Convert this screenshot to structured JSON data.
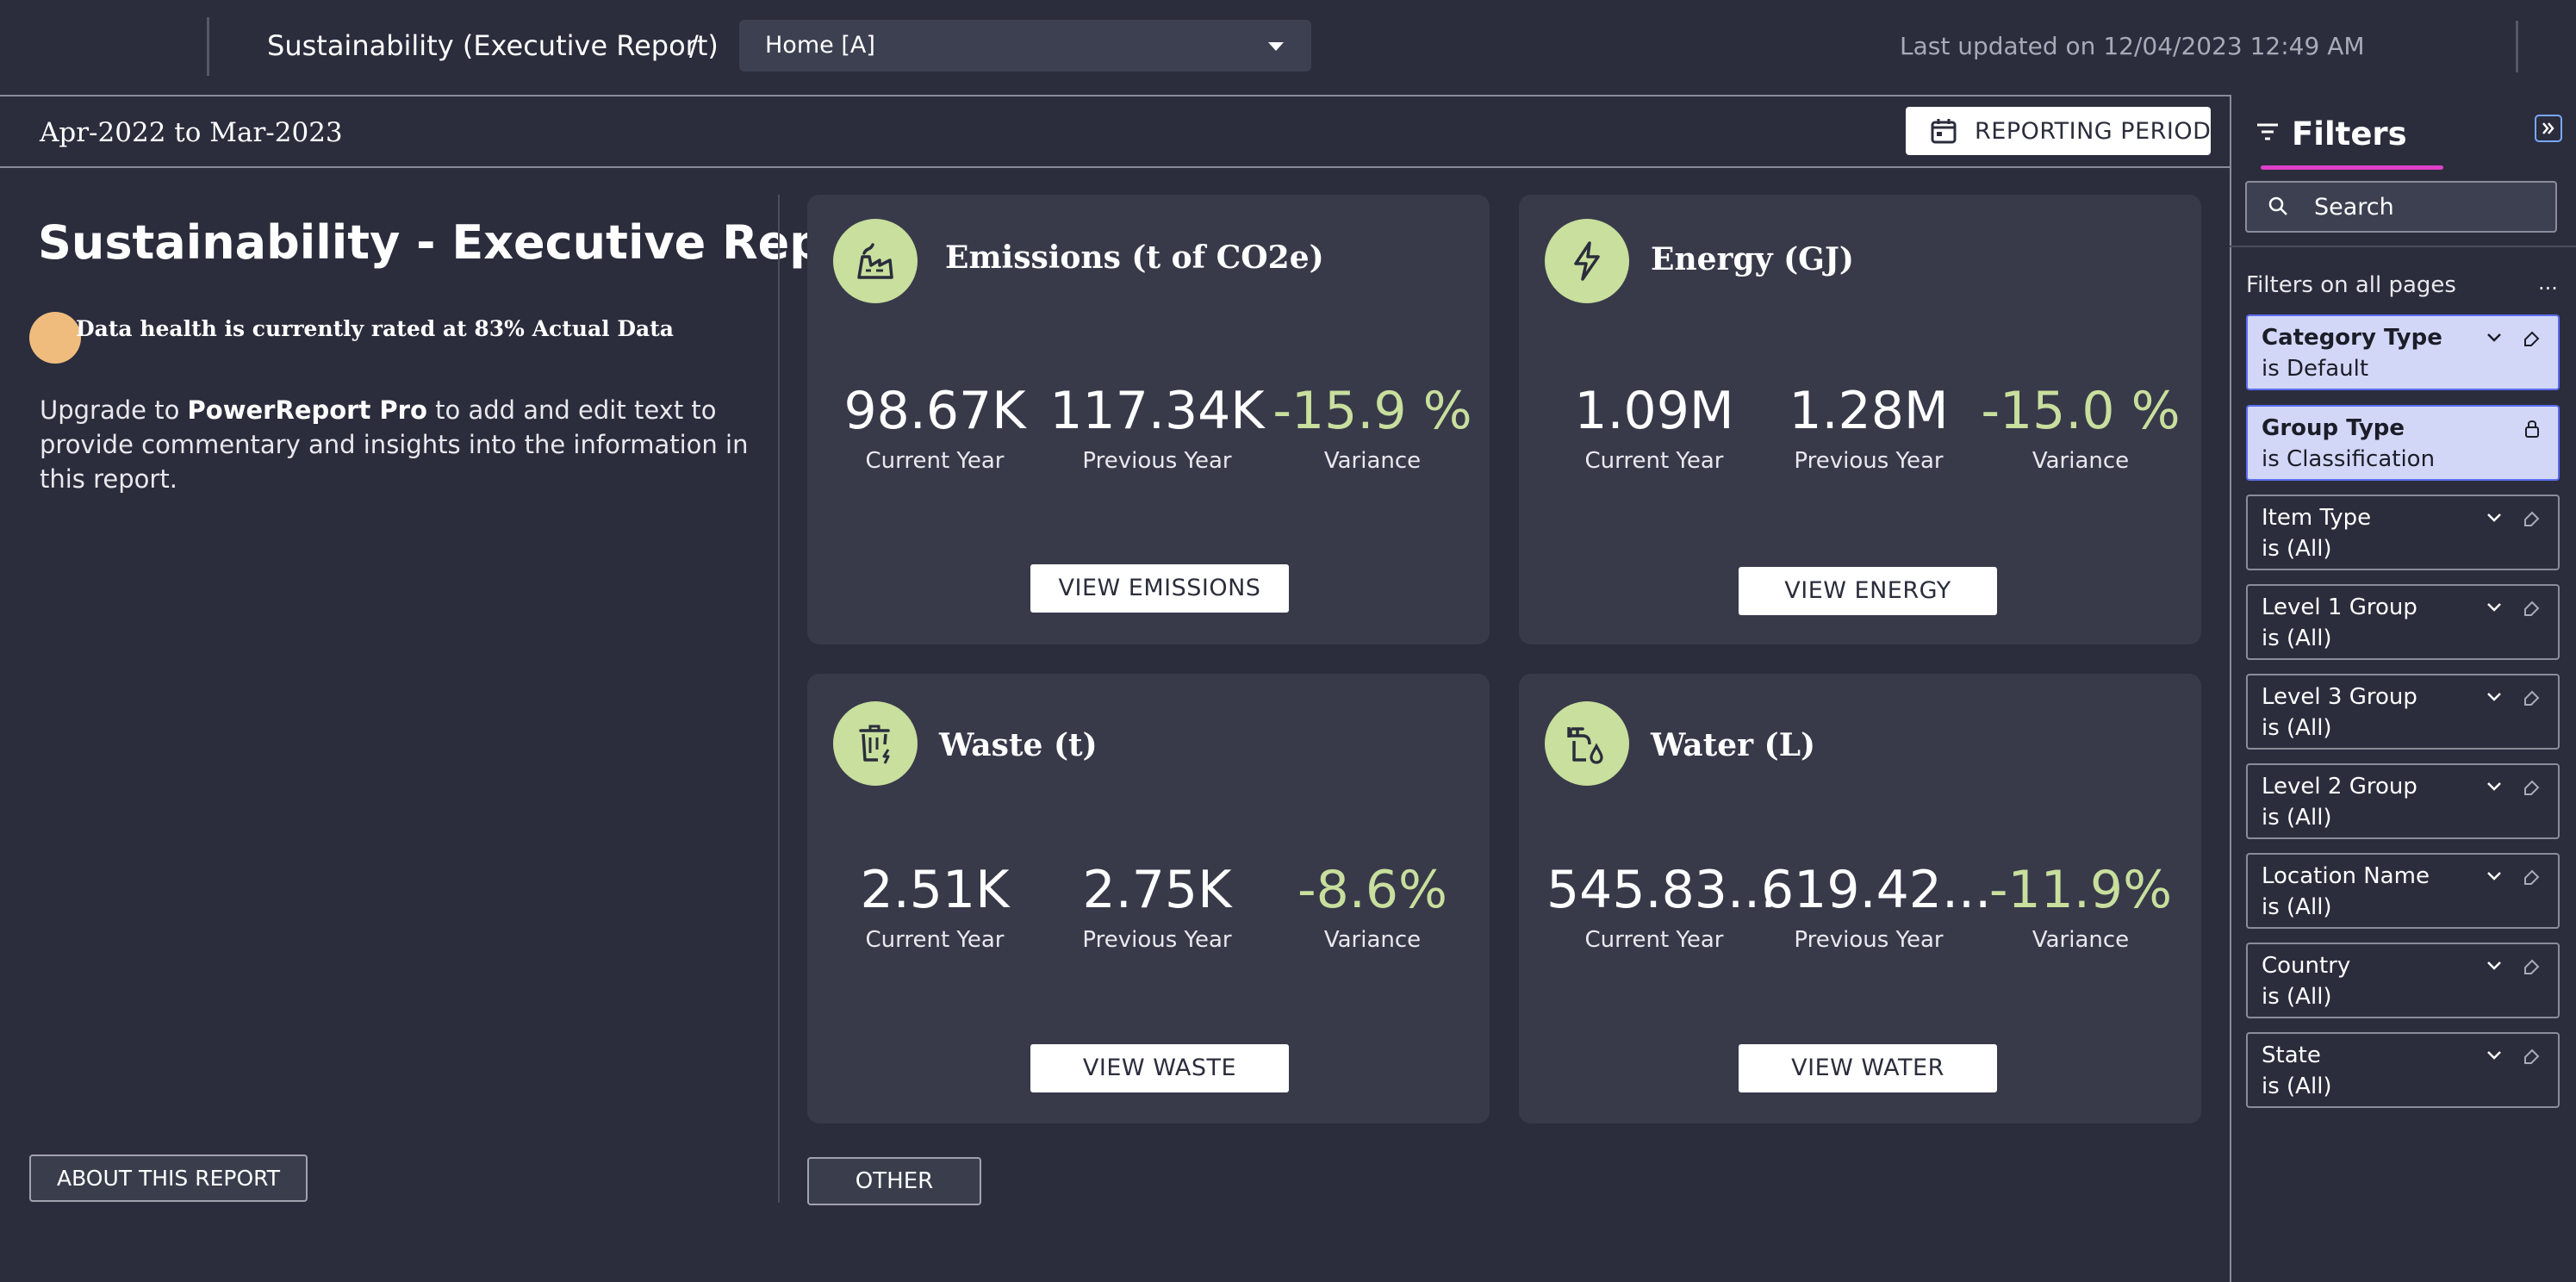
{
  "topbar": {
    "breadcrumb_title": "Sustainability (Executive Report)",
    "separator": "/",
    "page_select": "Home [A]",
    "last_updated": "Last updated on 12/04/2023 12:49 AM"
  },
  "subheader": {
    "period": "Apr-2022 to Mar-2023",
    "reporting_button": "REPORTING PERIOD"
  },
  "left_panel": {
    "title": "Sustainability - Executive Report",
    "health": "Data health is currently rated at 83% Actual Data",
    "upgrade_prefix": "Upgrade to ",
    "upgrade_brand": "PowerReport Pro",
    "upgrade_suffix": " to add and edit text to provide commentary and insights into the information in this report.",
    "about_button": "ABOUT THIS REPORT",
    "other_button": "OTHER"
  },
  "cards": {
    "emissions": {
      "title": "Emissions (t of CO2e)",
      "icon": "factory-icon",
      "current": "98.67K",
      "previous": "117.34K",
      "variance": "-15.9 %",
      "current_label": "Current Year",
      "previous_label": "Previous Year",
      "variance_label": "Variance",
      "button": "VIEW EMISSIONS"
    },
    "energy": {
      "title": "Energy (GJ)",
      "icon": "lightning-icon",
      "current": "1.09M",
      "previous": "1.28M",
      "variance": "-15.0 %",
      "current_label": "Current Year",
      "previous_label": "Previous Year",
      "variance_label": "Variance",
      "button": "VIEW ENERGY"
    },
    "waste": {
      "title": "Waste (t)",
      "icon": "trash-icon",
      "current": "2.51K",
      "previous": "2.75K",
      "variance": "-8.6%",
      "current_label": "Current Year",
      "previous_label": "Previous Year",
      "variance_label": "Variance",
      "button": "VIEW WASTE"
    },
    "water": {
      "title": "Water (L)",
      "icon": "water-tap-icon",
      "current": "545.83...",
      "previous": "619.42...",
      "variance": "-11.9%",
      "current_label": "Current Year",
      "previous_label": "Previous Year",
      "variance_label": "Variance",
      "button": "VIEW WATER"
    }
  },
  "filters": {
    "title": "Filters",
    "search_placeholder": "Search",
    "section_label": "Filters on all pages",
    "more": "...",
    "items": [
      {
        "name": "Category Type",
        "value": "is Default",
        "active": true
      },
      {
        "name": "Group Type",
        "value": "is Classification",
        "active": true,
        "locked": true
      },
      {
        "name": "Item Type",
        "value": "is (All)"
      },
      {
        "name": "Level 1 Group",
        "value": "is (All)"
      },
      {
        "name": "Level 3 Group",
        "value": "is (All)"
      },
      {
        "name": "Level 2 Group",
        "value": "is (All)"
      },
      {
        "name": "Location Name",
        "value": "is (All)"
      },
      {
        "name": "Country",
        "value": "is (All)"
      },
      {
        "name": "State",
        "value": "is (All)"
      }
    ]
  },
  "colors": {
    "background": "#2b2d3c",
    "card": "#383a4a",
    "accent_green": "#c8df9d",
    "health_dot": "#f0bc7e",
    "filter_active": "#d3d7f7",
    "filters_underline": "#e040c8"
  }
}
